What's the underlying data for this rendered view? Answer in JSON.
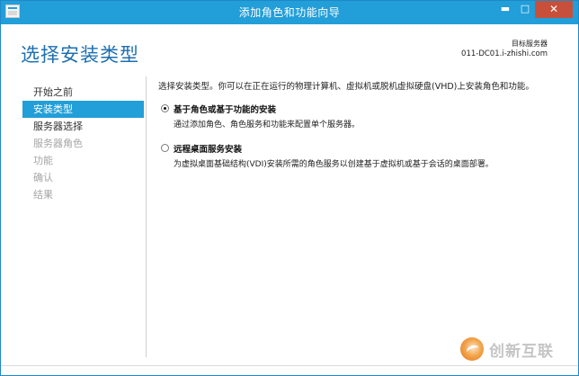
{
  "window": {
    "title": "添加角色和功能向导",
    "controls": {
      "minimize": "▬",
      "maximize": "□",
      "close": "✕"
    }
  },
  "header": {
    "page_title": "选择安装类型",
    "target_label": "目标服务器",
    "target_server": "011-DC01.i-zhishi.com"
  },
  "nav": {
    "items": [
      {
        "label": "开始之前",
        "state": "normal"
      },
      {
        "label": "安装类型",
        "state": "active"
      },
      {
        "label": "服务器选择",
        "state": "normal"
      },
      {
        "label": "服务器角色",
        "state": "disabled"
      },
      {
        "label": "功能",
        "state": "disabled"
      },
      {
        "label": "确认",
        "state": "disabled"
      },
      {
        "label": "结果",
        "state": "disabled"
      }
    ]
  },
  "main": {
    "intro": "选择安装类型。你可以在正在运行的物理计算机、虚拟机或脱机虚拟硬盘(VHD)上安装角色和功能。",
    "options": [
      {
        "label": "基于角色或基于功能的安装",
        "description": "通过添加角色、角色服务和功能来配置单个服务器。",
        "checked": true
      },
      {
        "label": "远程桌面服务安装",
        "description": "为虚拟桌面基础结构(VDI)安装所需的角色服务以创建基于虚拟机或基于会话的桌面部署。",
        "checked": false
      }
    ]
  },
  "watermark": {
    "text": "创新互联"
  },
  "colors": {
    "titlebar": "#229ed8",
    "accent": "#1c6fb0",
    "nav_active": "#229ed8",
    "close_button": "#c7503a"
  }
}
